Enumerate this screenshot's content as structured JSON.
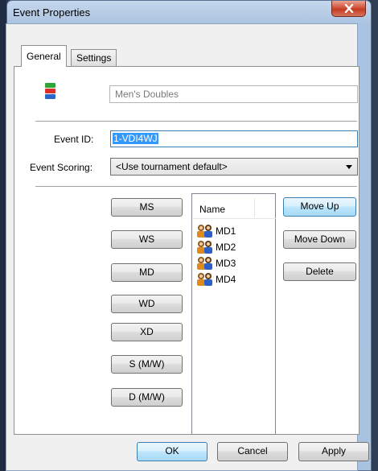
{
  "window": {
    "title": "Event Properties",
    "close_label": "x"
  },
  "tabs": [
    {
      "label": "General",
      "active": true
    },
    {
      "label": "Settings",
      "active": false
    }
  ],
  "general": {
    "event_name_placeholder": "Men's Doubles",
    "event_id_label": "Event ID:",
    "event_id_value": "1-VDI4WJ",
    "event_scoring_label": "Event Scoring:",
    "event_scoring_value": "<Use tournament default>"
  },
  "type_buttons": [
    "MS",
    "WS",
    "MD",
    "WD",
    "XD",
    "S (M/W)",
    "D (M/W)"
  ],
  "list": {
    "column_header": "Name",
    "items": [
      "MD1",
      "MD2",
      "MD3",
      "MD4"
    ]
  },
  "side_buttons": {
    "move_up": "Move Up",
    "move_down": "Move Down",
    "delete": "Delete"
  },
  "footer": {
    "ok": "OK",
    "cancel": "Cancel",
    "apply": "Apply"
  },
  "colors": {
    "selection": "#3399ff",
    "close_button": "#c94a30",
    "focus_border": "#3c7fb1"
  }
}
